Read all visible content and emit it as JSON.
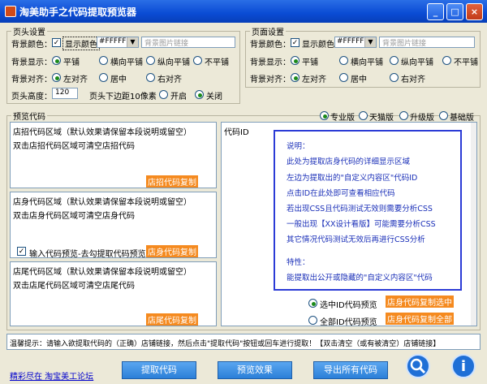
{
  "window": {
    "title": "淘美助手之代码提取预览器",
    "minimize": "_",
    "maximize": "□",
    "close": "×"
  },
  "header_settings": {
    "legend": "页头设置",
    "bg_color_label": "背景颜色：",
    "show_color_label": "显示颜色",
    "color_value": "#FFFFFF",
    "bg_image_placeholder": "背景图片链接",
    "bg_display_label": "背景显示：",
    "display_options": [
      "平铺",
      "横向平铺",
      "纵向平铺",
      "不平铺"
    ],
    "bg_align_label": "背景对齐：",
    "align_options": [
      "左对齐",
      "居中",
      "右对齐"
    ],
    "height_label": "页头高度：",
    "height_value": "120",
    "margin_label": "页头下边距10像素",
    "margin_options": [
      "开启",
      "关闭"
    ]
  },
  "page_settings": {
    "legend": "页面设置",
    "bg_color_label": "背景颜色：",
    "show_color_label": "显示颜色",
    "color_value": "#FFFFFF",
    "bg_image_placeholder": "背景图片链接",
    "bg_display_label": "背景显示：",
    "display_options": [
      "平铺",
      "横向平铺",
      "纵向平铺",
      "不平铺"
    ],
    "bg_align_label": "背景对齐：",
    "align_options": [
      "左对齐",
      "居中",
      "右对齐"
    ]
  },
  "preview": {
    "legend": "预览代码",
    "editions": [
      "专业版",
      "天猫版",
      "升级版",
      "基础版"
    ],
    "shop_sign": {
      "title": "店招代码区域（默认效果请保留本段说明或留空）",
      "hint": "双击店招代码区域可清空店招代码",
      "copy": "店招代码复制"
    },
    "shop_body": {
      "title": "店身代码区域（默认效果请保留本段说明或留空）",
      "hint": "双击店身代码区域可清空店身代码",
      "checkbox": "输入代码预览-去勾提取代码预览",
      "copy": "店身代码复制"
    },
    "shop_tail": {
      "title": "店尾代码区域（默认效果请保留本段说明或留空）",
      "hint": "双击店尾代码区域可清空店尾代码",
      "copy": "店尾代码复制"
    },
    "code_id_label": "代码ID",
    "explain": {
      "title": "说明：",
      "lines": [
        "此处为提取店身代码的详细显示区域",
        "左边为提取出的\"自定义内容区\"代码ID",
        "点击ID在此处即可查看相应代码",
        "若出现CSS且代码测试无效则需要分析CSS",
        "一般出现【XX设计看版】可能需要分析CSS",
        "其它情况代码测试无效后再进行CSS分析"
      ],
      "feature_title": "特性：",
      "feature_line": "能提取出公开或隐藏的\"自定义内容区\"代码"
    },
    "select_option": "选中ID代码预览",
    "all_option": "全部ID代码预览",
    "copy_selected": "店身代码复制选中",
    "copy_all": "店身代码复制全部"
  },
  "tip": "温馨提示：请输入欲提取代码的（正确）店铺链接，然后点击\"提取代码\"按钮或回车进行提取！【双击清空（或有被清空）店铺链接】",
  "footer": {
    "link": "精彩尽在 淘宝美工论坛",
    "extract": "提取代码",
    "preview": "预览效果",
    "export": "导出所有代码"
  }
}
